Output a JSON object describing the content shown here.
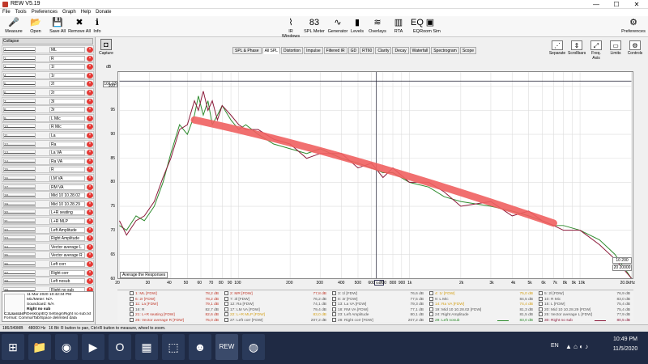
{
  "window": {
    "title": "REW V5.19",
    "minimize": "—",
    "maximize": "☐",
    "close": "✕"
  },
  "menu": [
    "File",
    "Tools",
    "Preferences",
    "Graph",
    "Help",
    "Donate"
  ],
  "toolbar": {
    "left": [
      {
        "label": "Measure",
        "icon": "microphone-icon",
        "glyph": "🎤"
      },
      {
        "label": "Open",
        "icon": "folder-icon",
        "glyph": "📂"
      },
      {
        "label": "Save All",
        "icon": "save-icon",
        "glyph": "💾"
      },
      {
        "label": "Remove All",
        "icon": "remove-icon",
        "glyph": "✖"
      },
      {
        "label": "Info",
        "icon": "info-icon",
        "glyph": "ℹ"
      }
    ],
    "center": [
      {
        "label": "IR Windows",
        "icon": "ir-window-icon",
        "glyph": "⌇"
      },
      {
        "label": "SPL Meter",
        "icon": "spl-meter-icon",
        "glyph": "83"
      },
      {
        "label": "Generator",
        "icon": "generator-icon",
        "glyph": "∿"
      },
      {
        "label": "Levels",
        "icon": "levels-icon",
        "glyph": "▮"
      },
      {
        "label": "Overlays",
        "icon": "overlays-icon",
        "glyph": "≋"
      },
      {
        "label": "RTA",
        "icon": "rta-icon",
        "glyph": "▥"
      },
      {
        "label": "EQ",
        "icon": "eq-icon",
        "glyph": "EQ"
      },
      {
        "label": "Room Sim",
        "icon": "room-sim-icon",
        "glyph": "▣"
      }
    ],
    "prefs": {
      "label": "Preferences",
      "icon": "gear-icon",
      "glyph": "⚙"
    }
  },
  "collapse_label": "Collapse",
  "measurements": [
    {
      "n": "1",
      "name": "ML"
    },
    {
      "n": "2",
      "name": "R"
    },
    {
      "n": "3",
      "name": "1l"
    },
    {
      "n": "4",
      "name": "1r"
    },
    {
      "n": "5",
      "name": "2l"
    },
    {
      "n": "6",
      "name": "2r"
    },
    {
      "n": "7",
      "name": "3l"
    },
    {
      "n": "8",
      "name": "3r"
    },
    {
      "n": "9",
      "name": "L Mic"
    },
    {
      "n": "10",
      "name": "R Mic"
    },
    {
      "n": "11",
      "name": "La"
    },
    {
      "n": "12",
      "name": "Ra"
    },
    {
      "n": "13",
      "name": "La VA"
    },
    {
      "n": "14",
      "name": "Ra VA"
    },
    {
      "n": "15",
      "name": "R"
    },
    {
      "n": "16",
      "name": "LM VA"
    },
    {
      "n": "17",
      "name": "RM VA"
    },
    {
      "n": "18",
      "name": "Mid 10 10.28.02"
    },
    {
      "n": "19",
      "name": "Mid 10 10.28.29"
    },
    {
      "n": "20",
      "name": "L+R seating"
    },
    {
      "n": "21",
      "name": "L+R MLP"
    },
    {
      "n": "22",
      "name": "Left Amplitude"
    },
    {
      "n": "23",
      "name": "Right Amplitude"
    },
    {
      "n": "24",
      "name": "Vector average L"
    },
    {
      "n": "25",
      "name": "Vector average R"
    },
    {
      "n": "26",
      "name": "Left corr"
    },
    {
      "n": "27",
      "name": "Right corr"
    },
    {
      "n": "28",
      "name": "Left nosub"
    },
    {
      "n": "29",
      "name": "Right no sub"
    }
  ],
  "info": {
    "title": "Right no sub",
    "date": "11 Mar 2020 10:42:34 PM",
    "dist": "Mic/Meter: N/A",
    "sound": "Soundcard: N/A",
    "path": "C:\\Users\\HP\\Desktop\\EQ Settings\\Right no sub.txt",
    "format": "Format: Comma/Tab/Space delimited data",
    "loaded": "32762 values loaded, 2 Hz to 23,997 Hz"
  },
  "capture_label": "Capture",
  "tabs": [
    "SPL & Phase",
    "All SPL",
    "Distortion",
    "Impulse",
    "Filtered IR",
    "GD",
    "RT60",
    "Clarity",
    "Decay",
    "Waterfall",
    "Spectrogram",
    "Scope"
  ],
  "active_tab": "All SPL",
  "right_controls": [
    {
      "label": "Separate",
      "icon": "separate-icon",
      "glyph": "⋰"
    },
    {
      "label": "Scrollbars",
      "icon": "scrollbars-icon",
      "glyph": "⇕"
    },
    {
      "label": "Freq. Axis",
      "icon": "freq-axis-icon",
      "glyph": "⤢"
    },
    {
      "label": "Limits",
      "icon": "limits-icon",
      "glyph": "▭"
    },
    {
      "label": "Controls",
      "icon": "controls-icon",
      "glyph": "⚙"
    }
  ],
  "chart_data": {
    "type": "line",
    "ylabel": "dB",
    "ylim": [
      20,
      103
    ],
    "yticks": [
      20,
      25,
      30,
      35,
      40,
      45,
      50,
      55,
      60,
      65,
      70,
      75,
      80,
      85,
      90,
      95,
      100
    ],
    "ylim_view": [
      60,
      103
    ],
    "xlim": [
      20,
      20000
    ],
    "xscale": "log",
    "xunit": "Hz",
    "xticks": [
      {
        "v": 20,
        "t": "20"
      },
      {
        "v": 30,
        "t": "30"
      },
      {
        "v": 40,
        "t": "40"
      },
      {
        "v": 50,
        "t": "50"
      },
      {
        "v": 60,
        "t": "60"
      },
      {
        "v": 70,
        "t": "70"
      },
      {
        "v": 80,
        "t": "80"
      },
      {
        "v": 90,
        "t": "90"
      },
      {
        "v": 100,
        "t": "100"
      },
      {
        "v": 200,
        "t": "200"
      },
      {
        "v": 300,
        "t": "300"
      },
      {
        "v": 400,
        "t": "400"
      },
      {
        "v": 500,
        "t": "500"
      },
      {
        "v": 600,
        "t": "600"
      },
      {
        "v": 700,
        "t": "700"
      },
      {
        "v": 800,
        "t": "800"
      },
      {
        "v": 900,
        "t": "900"
      },
      {
        "v": 1000,
        "t": "1k"
      },
      {
        "v": 2000,
        "t": "2k"
      },
      {
        "v": 3000,
        "t": "3k"
      },
      {
        "v": 4000,
        "t": "4k"
      },
      {
        "v": 5000,
        "t": "5k"
      },
      {
        "v": 6000,
        "t": "6k"
      },
      {
        "v": 7000,
        "t": "7k"
      },
      {
        "v": 8000,
        "t": "8k"
      },
      {
        "v": 9000,
        "t": "9k"
      },
      {
        "v": 10000,
        "t": "10k"
      },
      {
        "v": 20000,
        "t": "20.0kHz"
      }
    ],
    "cursor_readout": "101.13",
    "cursor_freq": "640",
    "series": [
      {
        "name": "28: Left nosub",
        "color": "#2e8b2e",
        "x": [
          20,
          22,
          25,
          28,
          32,
          36,
          40,
          45,
          50,
          55,
          58,
          62,
          66,
          70,
          75,
          80,
          90,
          100,
          110,
          130,
          160,
          200,
          250,
          300,
          400,
          500,
          600,
          700,
          800,
          1000,
          1300,
          1600,
          2000,
          3000,
          4000,
          5000,
          6000,
          7000,
          8000,
          10000,
          13000,
          16000,
          20000
        ],
        "y": [
          71,
          70,
          73,
          72,
          75,
          80,
          86,
          92,
          90,
          94,
          98,
          94,
          97,
          92,
          94,
          96,
          93,
          91,
          92,
          90,
          88,
          87,
          86,
          87,
          85,
          84,
          83,
          82,
          82,
          80,
          79,
          77,
          76,
          75,
          74,
          73,
          72,
          71,
          71,
          70,
          68,
          65,
          60
        ]
      },
      {
        "name": "29: Right no sub",
        "color": "#8b1a3a",
        "x": [
          20,
          22,
          25,
          28,
          32,
          36,
          40,
          45,
          50,
          55,
          58,
          62,
          66,
          70,
          75,
          80,
          90,
          100,
          110,
          130,
          160,
          200,
          250,
          300,
          400,
          500,
          600,
          700,
          800,
          1000,
          1300,
          1600,
          2000,
          3000,
          4000,
          5000,
          6000,
          7000,
          8000,
          10000,
          13000,
          16000,
          20000
        ],
        "y": [
          72,
          69,
          72,
          73,
          76,
          81,
          85,
          91,
          92,
          97,
          95,
          99,
          95,
          97,
          93,
          96,
          94,
          92,
          91,
          91,
          89,
          88,
          85,
          86,
          86,
          83,
          84,
          81,
          83,
          80,
          80,
          78,
          75,
          76,
          73,
          74,
          72,
          71,
          70,
          70,
          67,
          64,
          60
        ]
      }
    ],
    "annotation_overlay": {
      "color": "#f06060",
      "from": [
        55,
        93
      ],
      "to": [
        7000,
        71.5
      ]
    },
    "legend_text": "Average the Responses",
    "zoom": {
      "top": "10 200",
      "bottom": "20 20000"
    }
  },
  "legend": [
    {
      "label": "1: ML [FDW]",
      "value": "78,2 dB",
      "color": "#c0392b"
    },
    {
      "label": "2: MR [FDW]",
      "value": "77,8 dB",
      "color": "#c0392b"
    },
    {
      "label": "3: 1l [FDW]",
      "value": "76,6 dB",
      "color": "#555"
    },
    {
      "label": "4: 1r [FDW]",
      "value": "75,0 dB",
      "color": "#d4a017"
    },
    {
      "label": "5: 2l [FDW]",
      "value": "76,9 dB",
      "color": "#555"
    },
    {
      "label": "6: 2r [FDW]",
      "value": "78,2 dB",
      "color": "#c0392b"
    },
    {
      "label": "7: 3l [FDW]",
      "value": "76,2 dB",
      "color": "#555"
    },
    {
      "label": "8: 3r [FDW]",
      "value": "77,5 dB",
      "color": "#555"
    },
    {
      "label": "9: L Mic",
      "value": "84,5 dB",
      "color": "#555"
    },
    {
      "label": "10: R Mic",
      "value": "83,0 dB",
      "color": "#555"
    },
    {
      "label": "11: La [FDW]",
      "value": "79,1 dB",
      "color": "#c0392b"
    },
    {
      "label": "12: Ra [FDW]",
      "value": "74,1 dB",
      "color": "#555"
    },
    {
      "label": "13: La VA [FDW]",
      "value": "79,3 dB",
      "color": "#555"
    },
    {
      "label": "14: Ra VA [FDW]",
      "value": "74,4 dB",
      "color": "#d4a017"
    },
    {
      "label": "15: L [FDW]",
      "value": "75,4 dB",
      "color": "#555"
    },
    {
      "label": "16: R",
      "value": "82,7 dB",
      "color": "#555"
    },
    {
      "label": "17: LM VA [FDW]",
      "value": "79,4 dB",
      "color": "#555"
    },
    {
      "label": "18: RM VA [FDW]",
      "value": "77,1 dB",
      "color": "#555"
    },
    {
      "label": "19: Mid 10 10.28.02 [FDW]",
      "value": "81,3 dB",
      "color": "#555"
    },
    {
      "label": "20: Mid 10 10.28.29 [FDW]",
      "value": "75,4 dB",
      "color": "#555"
    },
    {
      "label": "21: L+R seating [FDW]",
      "value": "82,6 dB",
      "color": "#c0392b"
    },
    {
      "label": "22: L+R MLP [FDW]",
      "value": "83,0 dB",
      "color": "#d4a017"
    },
    {
      "label": "23: Left Amplitude",
      "value": "80,1 dB",
      "color": "#555"
    },
    {
      "label": "24: Right Amplitude",
      "value": "81,5 dB",
      "color": "#555"
    },
    {
      "label": "25: Vector average L [FDW]",
      "value": "77,9 dB",
      "color": "#555"
    },
    {
      "label": "26: Vector average R [FDW]",
      "value": "75,0 dB",
      "color": "#c0392b"
    },
    {
      "label": "27: Left corr [FDW]",
      "value": "207,2 dB",
      "color": "#555"
    },
    {
      "label": "28: Right corr [FDW]",
      "value": "207,2 dB",
      "color": "#555"
    },
    {
      "label": "29: Left nosub",
      "value": "83,0 dB",
      "color": "#2e8b2e",
      "checked": true
    },
    {
      "label": "30: Right no sub",
      "value": "80,5 dB",
      "color": "#8b1a3a",
      "checked": true
    }
  ],
  "status": {
    "mem": "186/349MB",
    "rate": "48000 Hz",
    "bits": "16 Bit",
    "hint": "R button to pan, Ctrl+R button to measure, wheel to zoom."
  },
  "taskbar": {
    "apps": [
      {
        "icon": "windows-start-icon",
        "glyph": "⊞",
        "color": "#2a3a5a"
      },
      {
        "icon": "file-explorer-icon",
        "glyph": "📁",
        "color": "#2a3a5a"
      },
      {
        "icon": "chrome-icon",
        "glyph": "◉",
        "color": "#2a3a5a"
      },
      {
        "icon": "media-player-icon",
        "glyph": "▶",
        "color": "#2a3a5a"
      },
      {
        "icon": "opera-icon",
        "glyph": "O",
        "color": "#2a3a5a"
      },
      {
        "icon": "calculator-icon",
        "glyph": "▦",
        "color": "#2a3a5a"
      },
      {
        "icon": "grid-app-icon",
        "glyph": "⬚",
        "color": "#2a3a5a"
      },
      {
        "icon": "alien-icon",
        "glyph": "☻",
        "color": "#2a3a5a"
      },
      {
        "icon": "rew-icon",
        "glyph": "REW",
        "color": "#3a4a6a"
      },
      {
        "icon": "audio-app-icon",
        "glyph": "◍",
        "color": "#2a3a5a"
      }
    ],
    "lang": "EN",
    "time": "10:49 PM",
    "date": "11/5/2020"
  }
}
